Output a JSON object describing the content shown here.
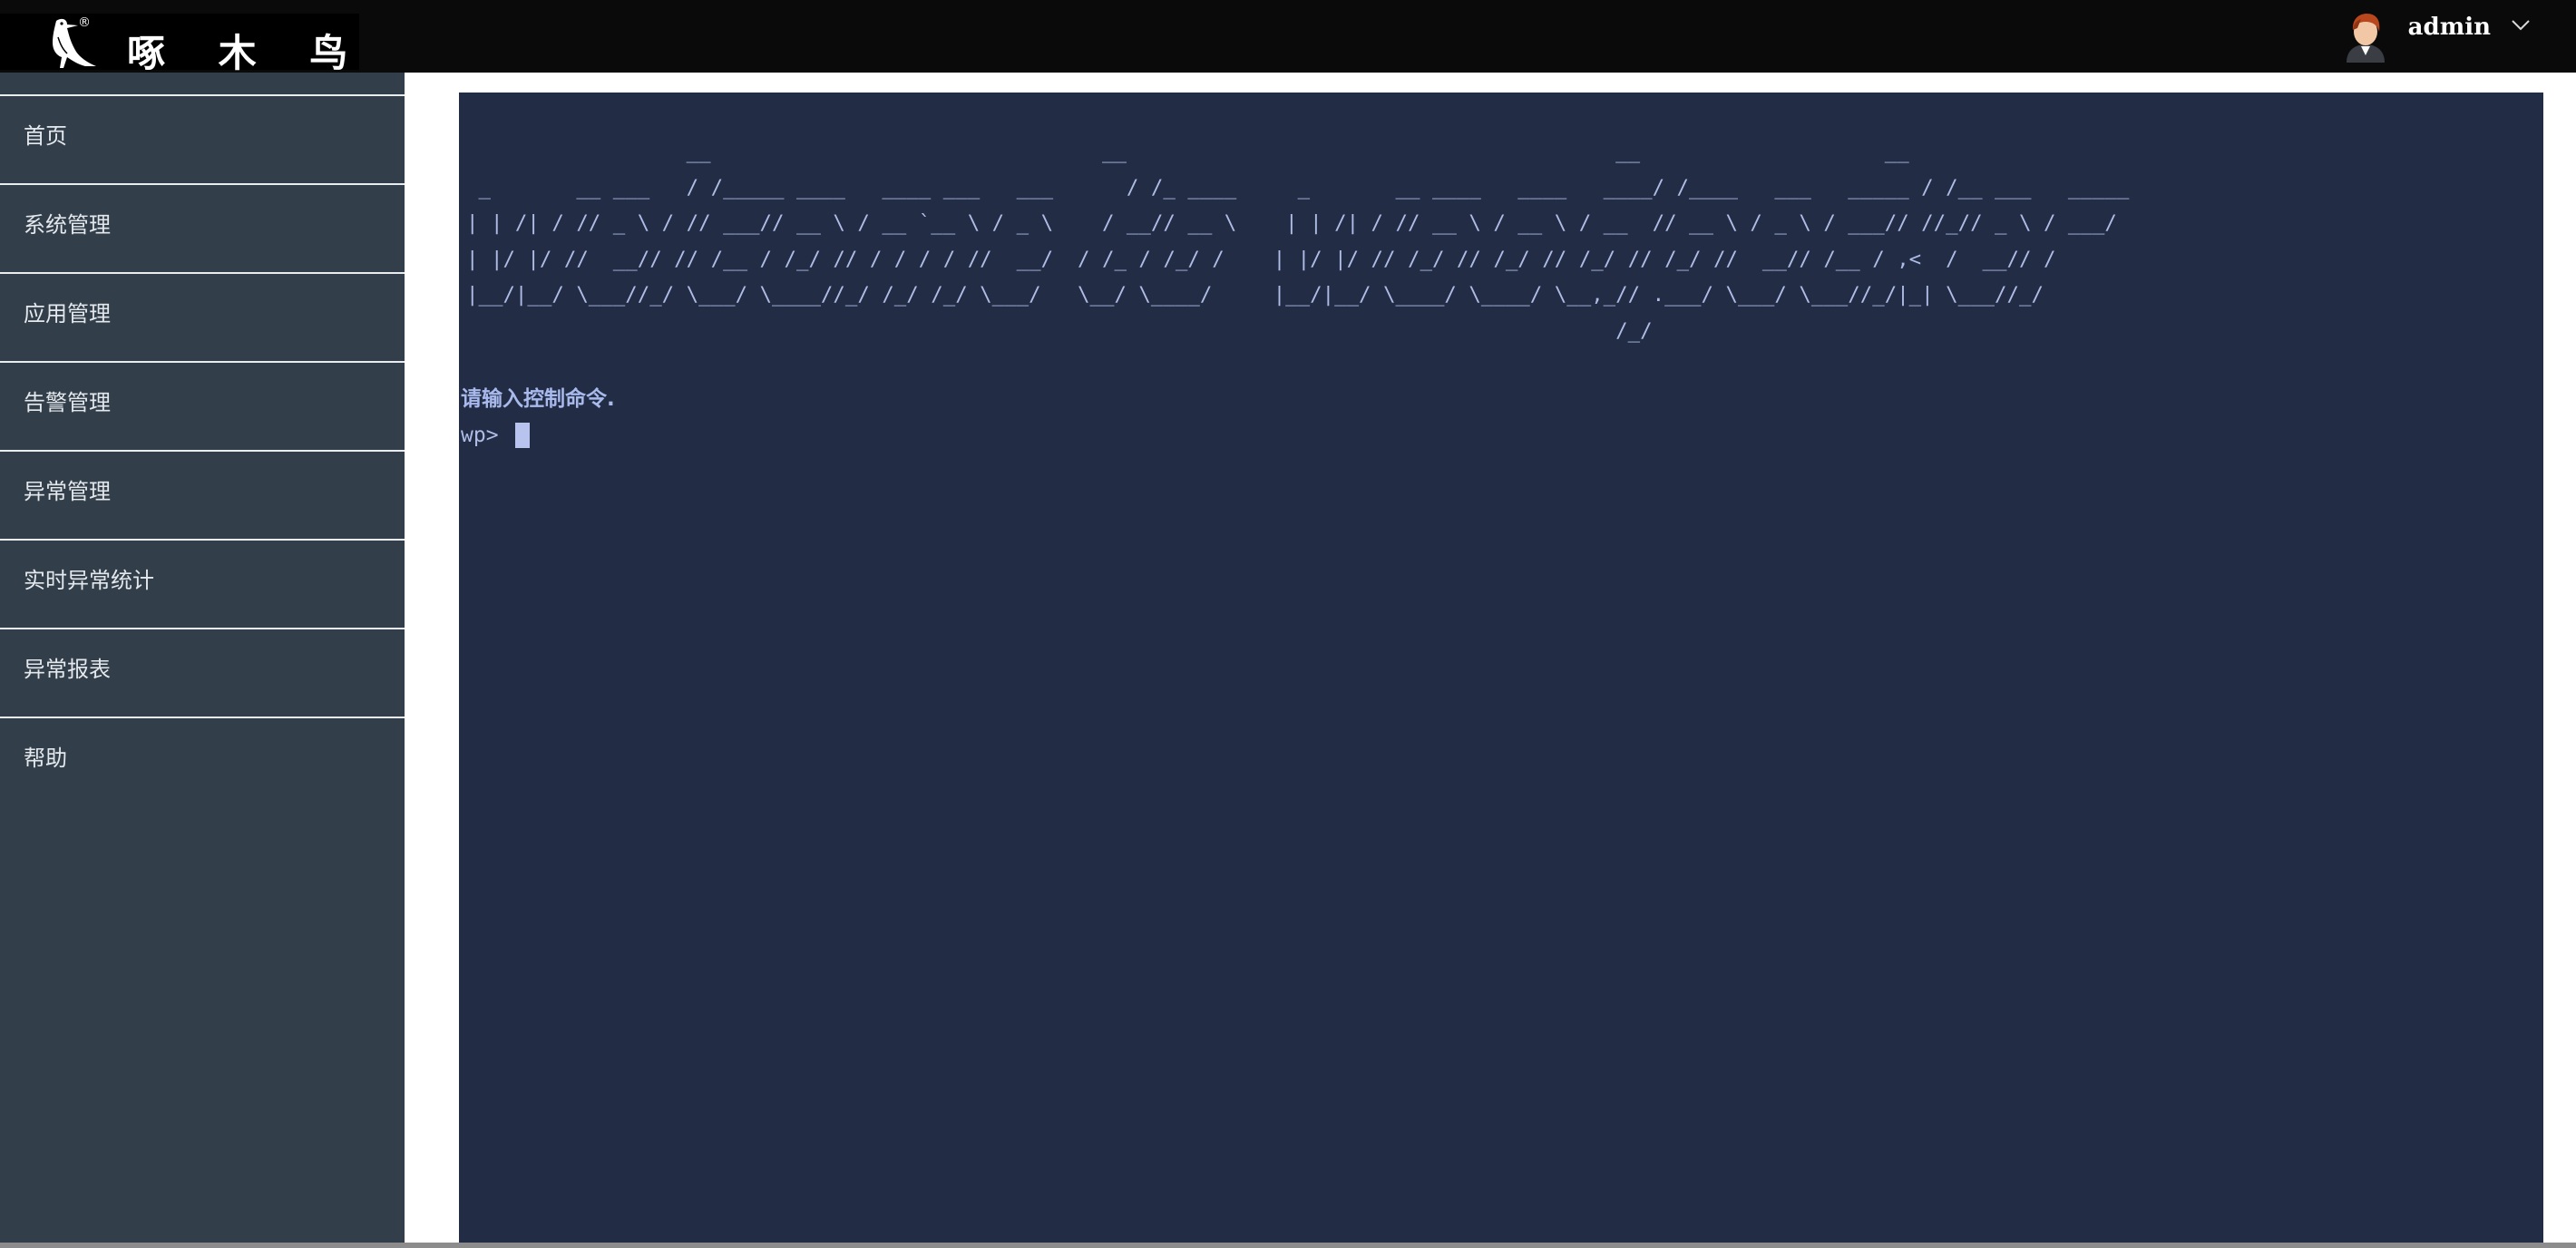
{
  "header": {
    "logo_text": "啄 木 鸟",
    "logo_reg": "®",
    "username": "admin",
    "icons": [
      "woodpecker-logo-icon",
      "user-avatar-icon",
      "chevron-down-icon"
    ]
  },
  "sidebar": {
    "items": [
      {
        "label": "首页"
      },
      {
        "label": "系统管理"
      },
      {
        "label": "应用管理"
      },
      {
        "label": "告警管理"
      },
      {
        "label": "异常管理"
      },
      {
        "label": "实时异常统计"
      },
      {
        "label": "异常报表"
      },
      {
        "label": "帮助"
      }
    ]
  },
  "terminal": {
    "banner": "                  __                                __                                        __                    __\n _       __ ___   / /_____ ____   ____ ___   ___      / /_ ____     _       __ ____   ____   ____/ /____   ___   _____ / /__ ___   _____\n| | /| / // _ \\ / // ___// __ \\ / __ `__ \\ / _ \\    / __// __ \\    | | /| / // __ \\ / __ \\ / __  // __ \\ / _ \\ / ___// //_// _ \\ / ___/\n| |/ |/ //  __// // /__ / /_/ // / / / / //  __/  / /_ / /_/ /    | |/ |/ // /_/ // /_/ // /_/ // /_/ //  __// /__ / ,<  /  __// /\n|__/|__/ \\___//_/ \\___/ \\____//_/ /_/ /_/ \\___/   \\__/ \\____/     |__/|__/ \\____/ \\____/ \\__,_// .___/ \\___/ \\___//_/|_| \\___//_/\n                                                                                              /_/",
    "message": "请输入控制命令.",
    "prompt": "wp>"
  }
}
